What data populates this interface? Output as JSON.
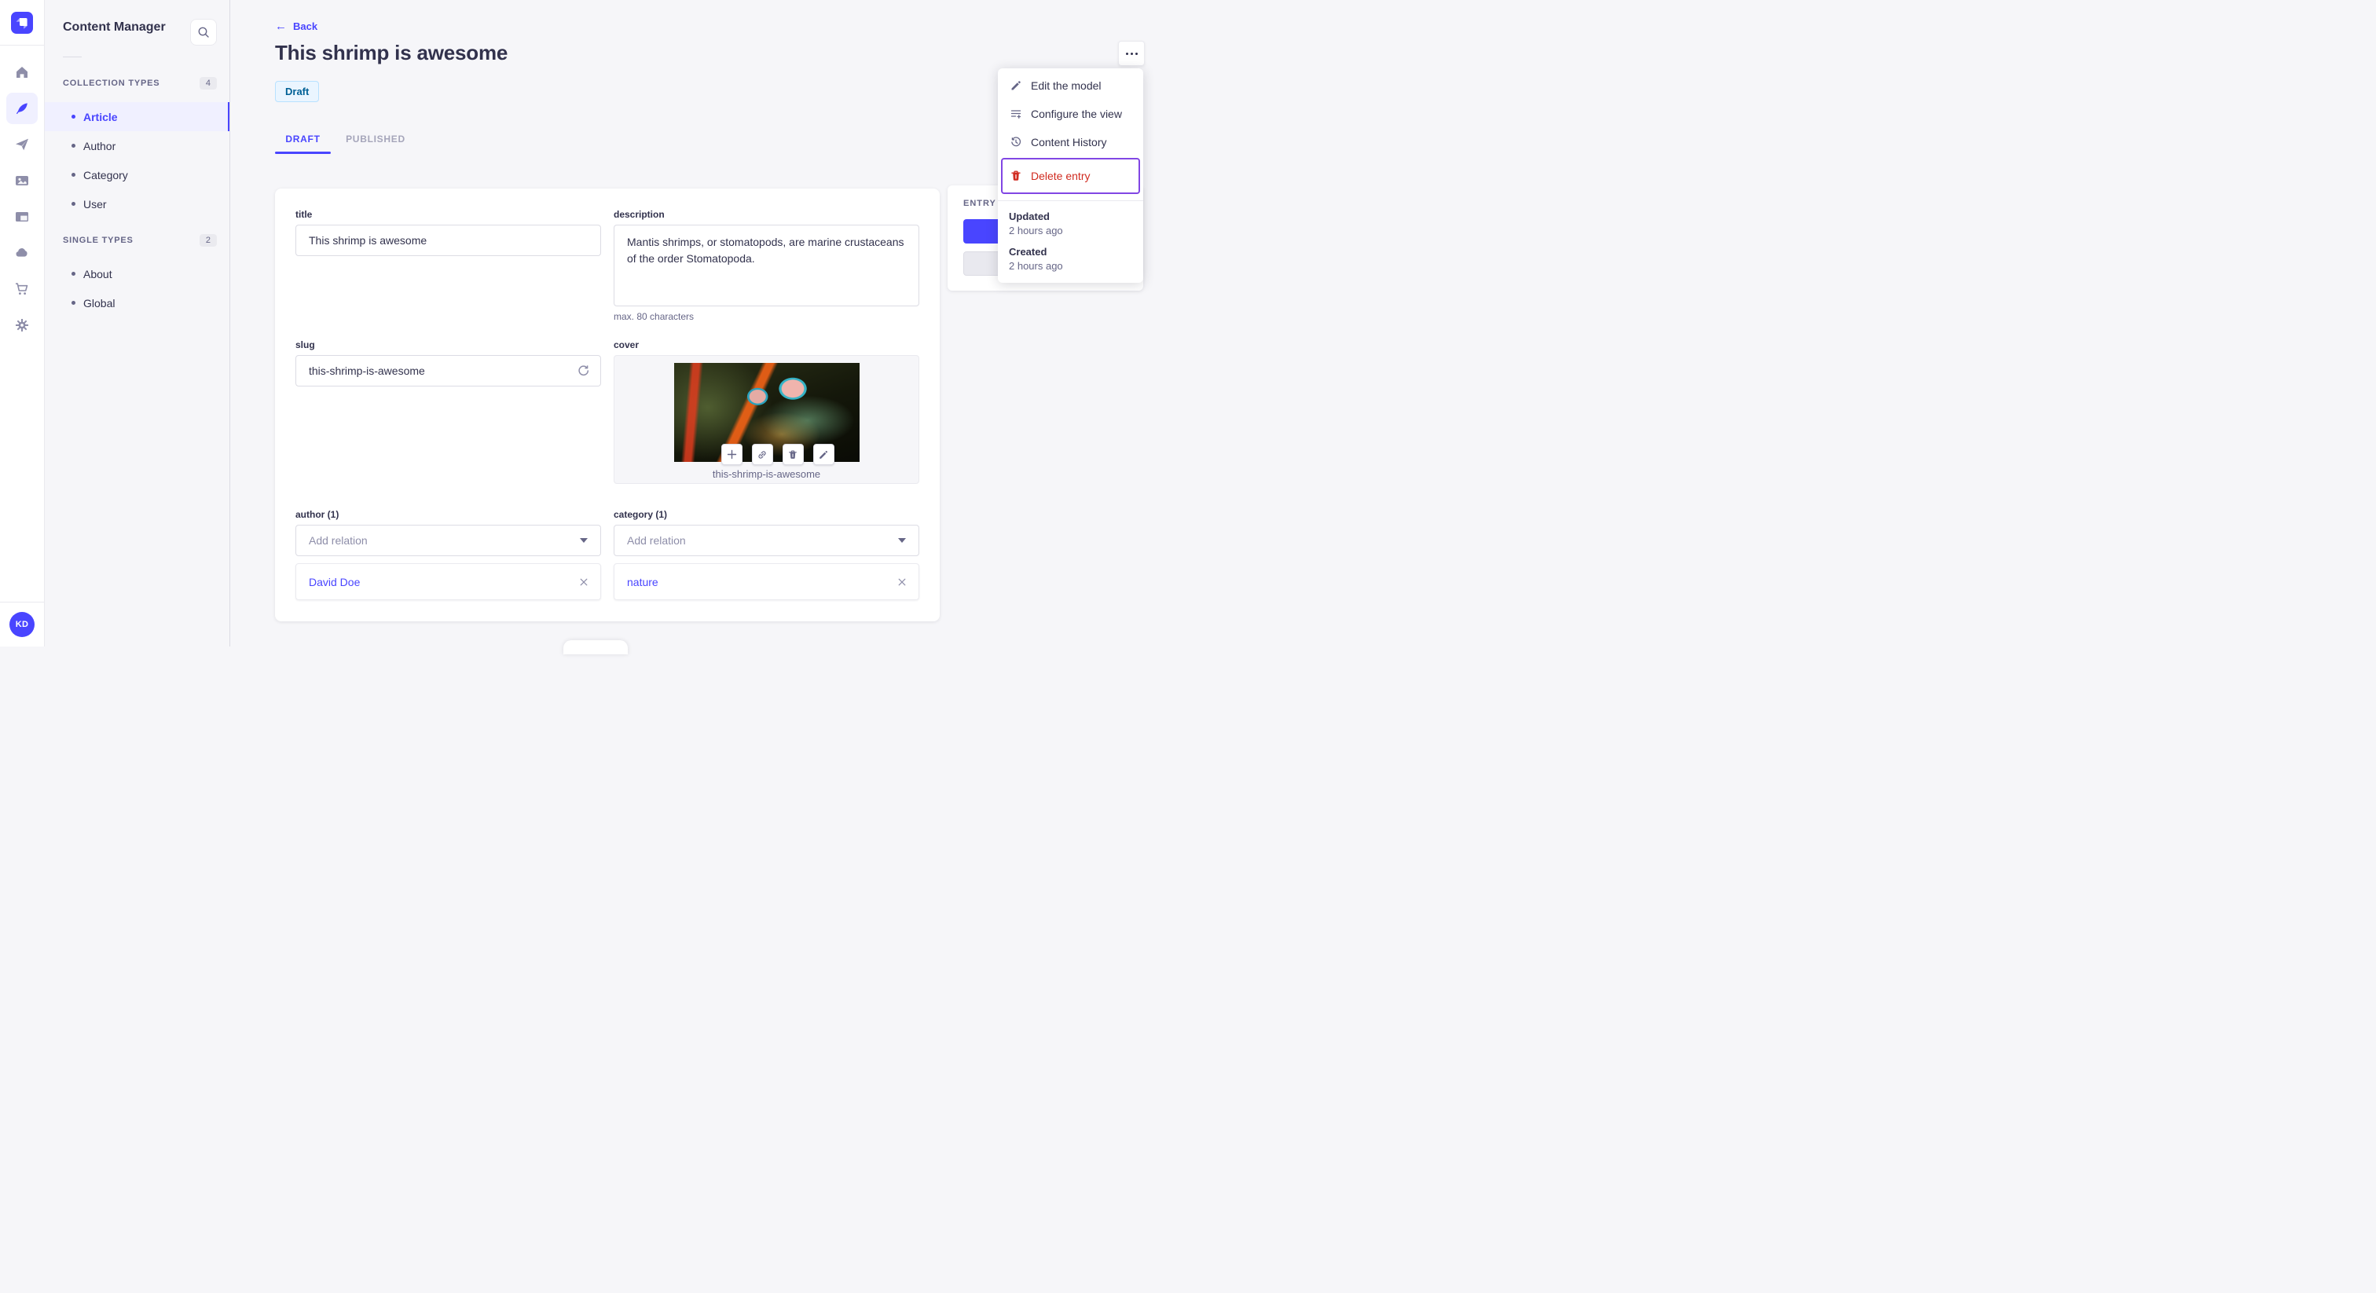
{
  "colors": {
    "primary": "#4945ff",
    "primary_light": "#f0f0ff",
    "danger": "#d02b20",
    "focus_ring": "#8146e4",
    "draft_bg": "#eaf5ff",
    "draft_border": "#b8e1ff",
    "draft_text": "#006096"
  },
  "nav_rail": {
    "avatar_initials": "KD"
  },
  "subnav": {
    "title": "Content Manager",
    "sections": [
      {
        "label": "COLLECTION TYPES",
        "count": "4",
        "items": [
          {
            "label": "Article"
          },
          {
            "label": "Author"
          },
          {
            "label": "Category"
          },
          {
            "label": "User"
          }
        ]
      },
      {
        "label": "SINGLE TYPES",
        "count": "2",
        "items": [
          {
            "label": "About"
          },
          {
            "label": "Global"
          }
        ]
      }
    ]
  },
  "header": {
    "back_label": "Back",
    "back_arrow": "←",
    "title": "This shrimp is awesome",
    "status_badge": "Draft",
    "tabs": [
      {
        "label": "DRAFT"
      },
      {
        "label": "PUBLISHED"
      }
    ]
  },
  "form": {
    "title": {
      "label": "title",
      "value": "This shrimp is awesome"
    },
    "description": {
      "label": "description",
      "value": "Mantis shrimps, or stomatopods, are marine crustaceans of the order Stomatopoda.",
      "hint": "max. 80 characters"
    },
    "slug": {
      "label": "slug",
      "value": "this-shrimp-is-awesome"
    },
    "cover": {
      "label": "cover",
      "caption": "this-shrimp-is-awesome"
    },
    "author": {
      "label": "author (1)",
      "placeholder": "Add relation",
      "items": [
        {
          "label": "David Doe",
          "remove": "✕"
        }
      ]
    },
    "category": {
      "label": "category (1)",
      "placeholder": "Add relation",
      "items": [
        {
          "label": "nature",
          "remove": "✕"
        }
      ]
    }
  },
  "entry_panel": {
    "label": "ENTRY"
  },
  "context_menu": {
    "items": [
      {
        "label": "Edit the model"
      },
      {
        "label": "Configure the view"
      },
      {
        "label": "Content History"
      },
      {
        "label": "Delete entry"
      }
    ],
    "meta": [
      {
        "label": "Updated",
        "value": "2 hours ago"
      },
      {
        "label": "Created",
        "value": "2 hours ago"
      }
    ]
  }
}
